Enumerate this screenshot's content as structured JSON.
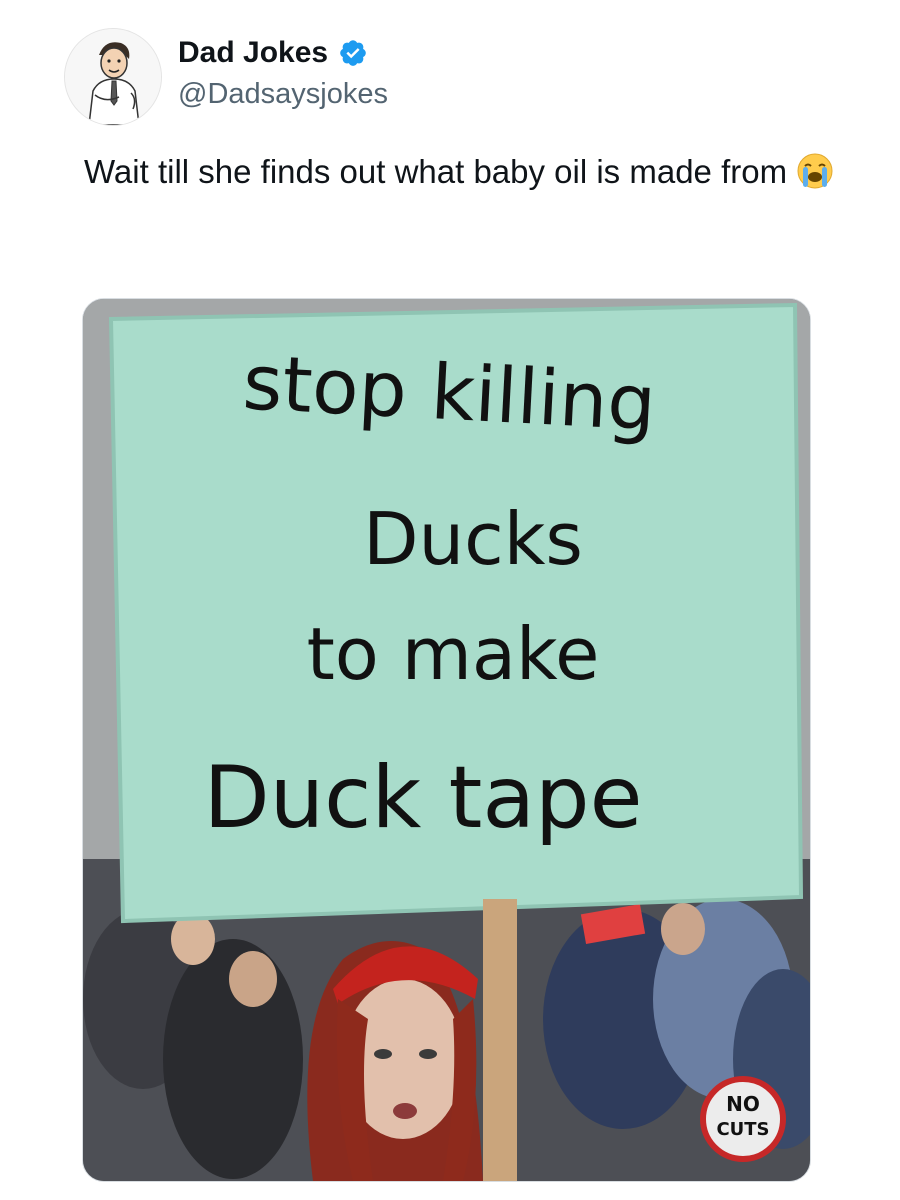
{
  "author": {
    "name": "Dad Jokes",
    "handle": "@Dadsaysjokes",
    "verified": true,
    "avatar_icon": "cartoon-dad-avatar-icon",
    "verified_icon": "verified-badge-icon",
    "verified_color": "#1d9bf0"
  },
  "tweet": {
    "text": "Wait till she finds out what baby oil is made from",
    "emoji_icon": "loudly-crying-face-emoji"
  },
  "media": {
    "sign": {
      "line1": "stop killing",
      "line2": "Ducks",
      "line3": "to make",
      "line4": "Duck tape",
      "color": "#a9dccb"
    },
    "small_sign": {
      "line1": "NO",
      "line2": "CUTS"
    }
  }
}
